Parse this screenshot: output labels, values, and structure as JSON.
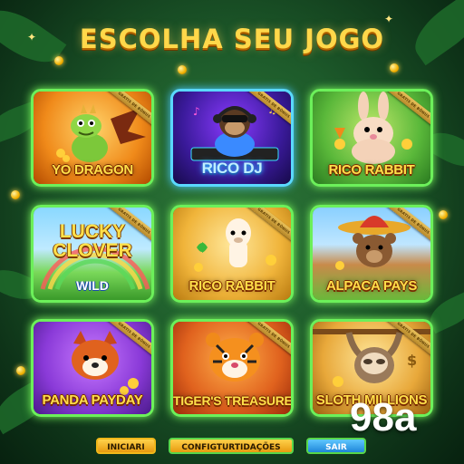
{
  "title": "ESCOLHA SEU JOGO",
  "ribbon_text": "GRATIS DE BÔNUS",
  "games": [
    {
      "name": "YO DRAGON",
      "theme": "dragon"
    },
    {
      "name": "RICO DJ",
      "theme": "dj-monkey"
    },
    {
      "name": "RICO RABBIT",
      "theme": "rabbit"
    },
    {
      "name": "LUCKY CLOVER",
      "subtitle": "WILD",
      "theme": "clover"
    },
    {
      "name": "RICO RABBIT",
      "theme": "alpaca"
    },
    {
      "name": "ALPACA PAYS",
      "theme": "bear"
    },
    {
      "name": "PANDA PAYDAY",
      "theme": "red-panda"
    },
    {
      "name": "TIGER'S TREASURE",
      "theme": "tiger"
    },
    {
      "name": "SLOTH MILLIONS",
      "theme": "sloth"
    }
  ],
  "buttons": {
    "start": "INICIARI",
    "config": "CONFIGTURTIDAÇÕES",
    "exit": "SAIR"
  },
  "watermark": "98a",
  "colors": {
    "title": "#ffd84a",
    "tile_border": "#6cf05a",
    "label": "#ffe04a",
    "button_gold": "#f0b81a",
    "button_blue": "#1f86d8"
  }
}
